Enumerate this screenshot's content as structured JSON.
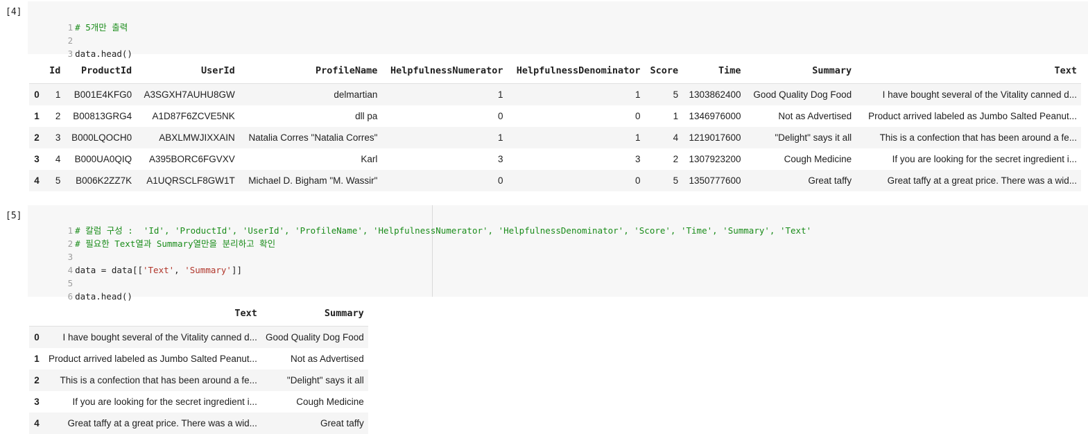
{
  "cell4": {
    "exec_count": "[4]",
    "lines": [
      {
        "num": "1",
        "comment": "# 5개만 출력"
      },
      {
        "num": "2"
      },
      {
        "num": "3",
        "code": "data.head()"
      }
    ],
    "table": {
      "columns": [
        "",
        "Id",
        "ProductId",
        "UserId",
        "ProfileName",
        "HelpfulnessNumerator",
        "HelpfulnessDenominator",
        "Score",
        "Time",
        "Summary",
        "Text"
      ],
      "rows": [
        [
          "0",
          "1",
          "B001E4KFG0",
          "A3SGXH7AUHU8GW",
          "delmartian",
          "1",
          "1",
          "5",
          "1303862400",
          "Good Quality Dog Food",
          "I have bought several of the Vitality canned d..."
        ],
        [
          "1",
          "2",
          "B00813GRG4",
          "A1D87F6ZCVE5NK",
          "dll pa",
          "0",
          "0",
          "1",
          "1346976000",
          "Not as Advertised",
          "Product arrived labeled as Jumbo Salted Peanut..."
        ],
        [
          "2",
          "3",
          "B000LQOCH0",
          "ABXLMWJIXXAIN",
          "Natalia Corres \"Natalia Corres\"",
          "1",
          "1",
          "4",
          "1219017600",
          "\"Delight\" says it all",
          "This is a confection that has been around a fe..."
        ],
        [
          "3",
          "4",
          "B000UA0QIQ",
          "A395BORC6FGVXV",
          "Karl",
          "3",
          "3",
          "2",
          "1307923200",
          "Cough Medicine",
          "If you are looking for the secret ingredient i..."
        ],
        [
          "4",
          "5",
          "B006K2ZZ7K",
          "A1UQRSCLF8GW1T",
          "Michael D. Bigham \"M. Wassir\"",
          "0",
          "0",
          "5",
          "1350777600",
          "Great taffy",
          "Great taffy at a great price. There was a wid..."
        ]
      ]
    }
  },
  "cell5": {
    "exec_count": "[5]",
    "lines": [
      {
        "num": "1",
        "comment": "# 칼럼 구성 :  'Id', 'ProductId', 'UserId', 'ProfileName', 'HelpfulnessNumerator', 'HelpfulnessDenominator', 'Score', 'Time', 'Summary', 'Text'"
      },
      {
        "num": "2",
        "comment": "# 필요한 Text열과 Summary열만을 분리하고 확인"
      },
      {
        "num": "3"
      },
      {
        "num": "4",
        "code": "data = data[[",
        "str1": "'Text'",
        "code2": ", ",
        "str2": "'Summary'",
        "code3": "]]"
      },
      {
        "num": "5"
      },
      {
        "num": "6",
        "code": "data.head()"
      }
    ],
    "table": {
      "columns": [
        "",
        "Text",
        "Summary"
      ],
      "rows": [
        [
          "0",
          "I have bought several of the Vitality canned d...",
          "Good Quality Dog Food"
        ],
        [
          "1",
          "Product arrived labeled as Jumbo Salted Peanut...",
          "Not as Advertised"
        ],
        [
          "2",
          "This is a confection that has been around a fe...",
          "\"Delight\" says it all"
        ],
        [
          "3",
          "If you are looking for the secret ingredient i...",
          "Cough Medicine"
        ],
        [
          "4",
          "Great taffy at a great price. There was a wid...",
          "Great taffy"
        ]
      ]
    }
  }
}
